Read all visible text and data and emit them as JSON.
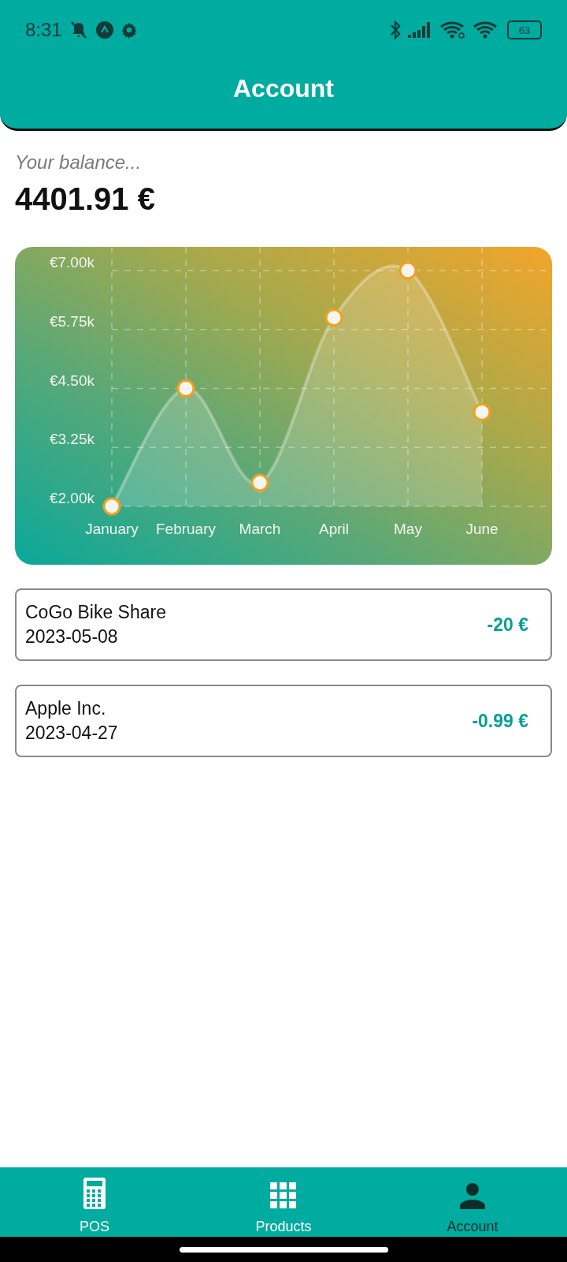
{
  "status_bar": {
    "time": "8:31",
    "battery": "63"
  },
  "header": {
    "title": "Account"
  },
  "balance": {
    "label": "Your balance...",
    "amount": "4401.91 €"
  },
  "chart": {
    "chart_data": {
      "type": "area",
      "categories": [
        "January",
        "February",
        "March",
        "April",
        "May",
        "June"
      ],
      "values": [
        2000,
        4500,
        2500,
        6000,
        7000,
        4000
      ],
      "ylim": [
        2000,
        7000
      ],
      "grid": true,
      "yticks": [
        {
          "value": 2000,
          "label": "€2.00k"
        },
        {
          "value": 3250,
          "label": "€3.25k"
        },
        {
          "value": 4500,
          "label": "€4.50k"
        },
        {
          "value": 5750,
          "label": "€5.75k"
        },
        {
          "value": 7000,
          "label": "€7.00k"
        }
      ]
    }
  },
  "transactions": [
    {
      "merchant": "CoGo Bike Share",
      "date": "2023-05-08",
      "amount": "-20 €"
    },
    {
      "merchant": "Apple Inc.",
      "date": "2023-04-27",
      "amount": "-0.99 €"
    }
  ],
  "nav": [
    {
      "kind": "calculator",
      "label": "POS",
      "selected": false
    },
    {
      "kind": "grid",
      "label": "Products",
      "selected": false
    },
    {
      "kind": "person",
      "label": "Account",
      "selected": true
    }
  ]
}
